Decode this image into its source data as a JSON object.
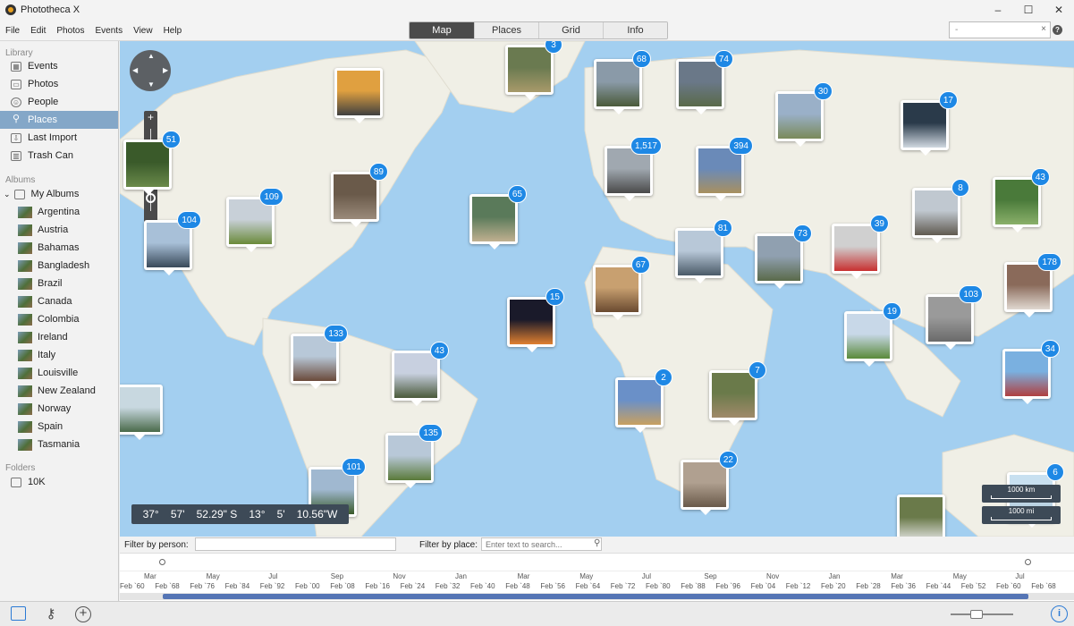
{
  "window": {
    "title": "Phototheca X",
    "controls": [
      "–",
      "☐",
      "✕"
    ]
  },
  "menu": [
    "File",
    "Edit",
    "Photos",
    "Events",
    "View",
    "Help"
  ],
  "view_tabs": [
    {
      "label": "Map",
      "active": true
    },
    {
      "label": "Places",
      "active": false
    },
    {
      "label": "Grid",
      "active": false
    },
    {
      "label": "Info",
      "active": false
    }
  ],
  "search": {
    "value": "-",
    "clear": "×",
    "help": "?"
  },
  "sidebar": {
    "library_header": "Library",
    "library": [
      {
        "label": "Events",
        "icon": "calendar-icon",
        "active": false
      },
      {
        "label": "Photos",
        "icon": "photos-icon",
        "active": false
      },
      {
        "label": "People",
        "icon": "person-icon",
        "active": false
      },
      {
        "label": "Places",
        "icon": "pin-icon",
        "active": true
      },
      {
        "label": "Last Import",
        "icon": "import-icon",
        "active": false
      },
      {
        "label": "Trash Can",
        "icon": "trash-icon",
        "active": false
      }
    ],
    "albums_header": "Albums",
    "my_albums": "My Albums",
    "albums": [
      "Argentina",
      "Austria",
      "Bahamas",
      "Bangladesh",
      "Brazil",
      "Canada",
      "Colombia",
      "Ireland",
      "Italy",
      "Louisville",
      "New Zealand",
      "Norway",
      "Spain",
      "Tasmania"
    ],
    "folders_header": "Folders",
    "folders": [
      "10K"
    ]
  },
  "map": {
    "zoom_plus": "+",
    "zoom_minus": "–",
    "pins": [
      {
        "count": "3",
        "c1": "#6a7a50",
        "c2": "#a89a6a"
      },
      {
        "count": "68",
        "c1": "#8a9aa8",
        "c2": "#4a5a3a"
      },
      {
        "count": "74",
        "c1": "#6a7888",
        "c2": "#5a6a4a"
      },
      {
        "count": "30",
        "c1": "#9ab0c8",
        "c2": "#7a8a5a"
      },
      {
        "count": "17",
        "c1": "#2a3a4a",
        "c2": "#d0d8e0"
      },
      {
        "count": "",
        "c1": "#e0a040",
        "c2": "#404040"
      },
      {
        "count": "51",
        "c1": "#3a5a2a",
        "c2": "#6a8a4a"
      },
      {
        "count": "109",
        "c1": "#c8d0d8",
        "c2": "#6a8a3a"
      },
      {
        "count": "89",
        "c1": "#6a5a4a",
        "c2": "#9a8a7a"
      },
      {
        "count": "65",
        "c1": "#5a7a5a",
        "c2": "#c0b090"
      },
      {
        "count": "1,517",
        "c1": "#a0a8b0",
        "c2": "#4a4a4a"
      },
      {
        "count": "394",
        "c1": "#6a8ab8",
        "c2": "#a89060"
      },
      {
        "count": "8",
        "c1": "#c0c8d0",
        "c2": "#605a50"
      },
      {
        "count": "43",
        "c1": "#4a7a3a",
        "c2": "#8ab06a"
      },
      {
        "count": "104",
        "c1": "#a8c0d8",
        "c2": "#3a4a5a"
      },
      {
        "count": "81",
        "c1": "#b8c8d8",
        "c2": "#4a5a68"
      },
      {
        "count": "73",
        "c1": "#90a0b0",
        "c2": "#5a6a4a"
      },
      {
        "count": "39",
        "c1": "#d0d0d0",
        "c2": "#c83030"
      },
      {
        "count": "178",
        "c1": "#8a6a5a",
        "c2": "#e0d8d0"
      },
      {
        "count": "67",
        "c1": "#c8a070",
        "c2": "#6a4a30"
      },
      {
        "count": "15",
        "c1": "#1a1a2a",
        "c2": "#e08030"
      },
      {
        "count": "103",
        "c1": "#9a9a9a",
        "c2": "#6a6a6a"
      },
      {
        "count": "19",
        "c1": "#c8d8e8",
        "c2": "#5a8a3a"
      },
      {
        "count": "133",
        "c1": "#b8c8d8",
        "c2": "#6a4a3a"
      },
      {
        "count": "43",
        "c1": "#c8d0e0",
        "c2": "#4a5a3a"
      },
      {
        "count": "2",
        "c1": "#6a90c8",
        "c2": "#c8a060"
      },
      {
        "count": "7",
        "c1": "#6a7a4a",
        "c2": "#a08a6a"
      },
      {
        "count": "34",
        "c1": "#7ab0e0",
        "c2": "#b04040"
      },
      {
        "count": "",
        "c1": "#c8d8e0",
        "c2": "#4a6a4a"
      },
      {
        "count": "135",
        "c1": "#b8c8d8",
        "c2": "#5a7a3a"
      },
      {
        "count": "22",
        "c1": "#b0a090",
        "c2": "#6a5a4a"
      },
      {
        "count": "101",
        "c1": "#a0b8d0",
        "c2": "#3a5a2a"
      },
      {
        "count": "6",
        "c1": "#c8e0f0",
        "c2": "#a8c0d0"
      },
      {
        "count": "",
        "c1": "#6a7a4a",
        "c2": "#e8e8e8"
      }
    ],
    "coords": [
      "37°",
      "57'",
      "52.29\" S",
      "13°",
      "5'",
      "10.56\"W"
    ],
    "scale_km": "1000 km",
    "scale_mi": "1000 mi"
  },
  "filters": {
    "person_label": "Filter by person:",
    "person_value": "",
    "place_label": "Filter by place:",
    "place_placeholder": "Enter text to search..."
  },
  "timeline": {
    "months": [
      "Mar",
      "May",
      "Jul",
      "Sep",
      "Nov",
      "Jan",
      "Mar",
      "May",
      "Jul",
      "Sep",
      "Nov",
      "Jan",
      "Mar",
      "May",
      "Jul"
    ],
    "years": [
      "Feb `60",
      "Feb `68",
      "Feb `76",
      "Feb `84",
      "Feb `92",
      "Feb `00",
      "Feb `08",
      "Feb `16",
      "Feb `24",
      "Feb `32",
      "Feb `40",
      "Feb `48",
      "Feb `56",
      "Feb `64",
      "Feb `72",
      "Feb `80",
      "Feb `88",
      "Feb `96",
      "Feb `04",
      "Feb `12",
      "Feb `20",
      "Feb `28",
      "Feb `36",
      "Feb `44",
      "Feb `52",
      "Feb `60",
      "Feb `68"
    ]
  },
  "bottom": {
    "info": "i",
    "add": "+"
  }
}
